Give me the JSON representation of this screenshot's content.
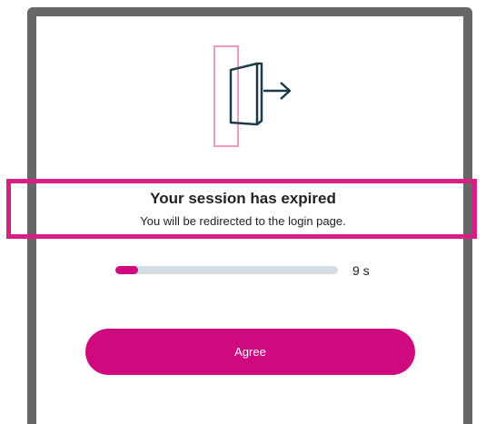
{
  "dialog": {
    "icon": "door-exit-icon",
    "title": "Your session has expired",
    "message": "You will be redirected to the login page.",
    "countdown": {
      "value": "9 s",
      "progress_fraction": 0.1
    },
    "agree_label": "Agree"
  },
  "colors": {
    "accent": "#cf0a7f",
    "highlight": "#d61e83",
    "progress_track": "#d4dde3",
    "frame": "#676767"
  }
}
